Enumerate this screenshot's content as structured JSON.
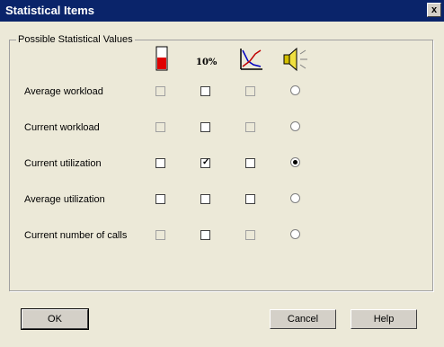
{
  "window": {
    "title": "Statistical Items",
    "close_label": "x"
  },
  "group": {
    "label": "Possible Statistical Values"
  },
  "columns": [
    {
      "icon": "thermometer-icon",
      "label": ""
    },
    {
      "icon": "percent-icon",
      "label": "10%"
    },
    {
      "icon": "chart-icon",
      "label": ""
    },
    {
      "icon": "speaker-icon",
      "label": ""
    }
  ],
  "rows": [
    {
      "label": "Average workload",
      "checks": [
        false,
        false,
        false
      ],
      "disabled": [
        true,
        false,
        true
      ],
      "radio": false
    },
    {
      "label": "Current workload",
      "checks": [
        false,
        false,
        false
      ],
      "disabled": [
        true,
        false,
        true
      ],
      "radio": false
    },
    {
      "label": "Current utilization",
      "checks": [
        false,
        true,
        false
      ],
      "disabled": [
        false,
        false,
        false
      ],
      "radio": true
    },
    {
      "label": "Average utilization",
      "checks": [
        false,
        false,
        false
      ],
      "disabled": [
        false,
        false,
        false
      ],
      "radio": false
    },
    {
      "label": "Current number of calls",
      "checks": [
        false,
        false,
        false
      ],
      "disabled": [
        true,
        false,
        true
      ],
      "radio": false
    }
  ],
  "buttons": {
    "ok": "OK",
    "cancel": "Cancel",
    "help": "Help"
  }
}
